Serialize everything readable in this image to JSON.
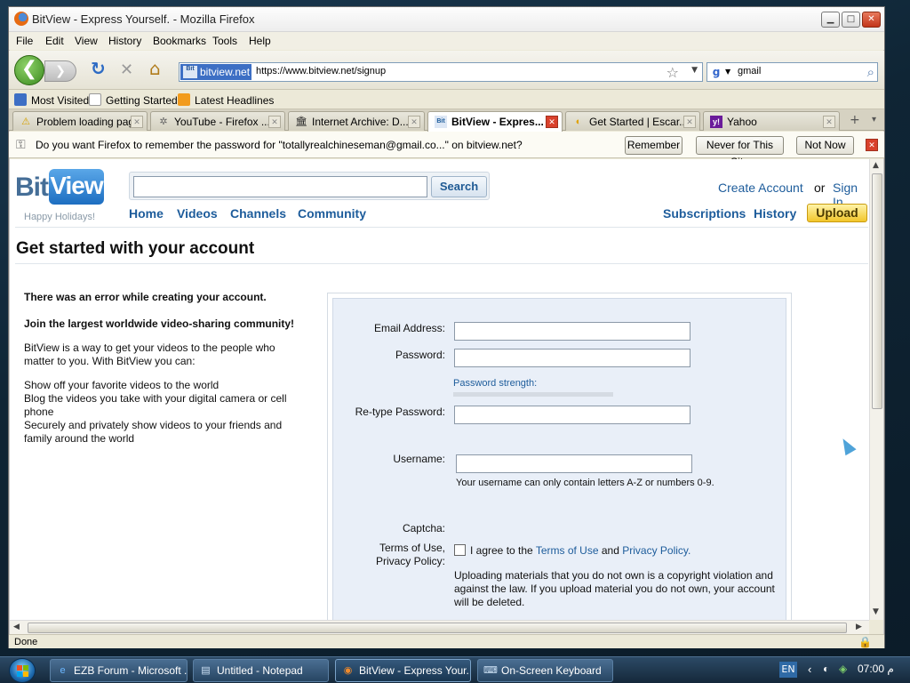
{
  "window": {
    "title": "BitView - Express Yourself. - Mozilla Firefox",
    "controls": {
      "minimize": "▁",
      "maximize": "□",
      "close": "✕"
    }
  },
  "menu": [
    "File",
    "Edit",
    "View",
    "History",
    "Bookmarks",
    "Tools",
    "Help"
  ],
  "nav": {
    "back": "❮",
    "forward": "❯",
    "reload": "↻",
    "stop": "✕",
    "home": "⌂",
    "site_identity": "bitview.net",
    "site_icon_text": "Bit",
    "url": "https://www.bitview.net/signup",
    "search_engine": "g",
    "search_value": "gmail"
  },
  "bookmarks": [
    {
      "label": "Most Visited",
      "icon": "most-visited-icon",
      "color": "#3d6fc4"
    },
    {
      "label": "Getting Started",
      "icon": "page-icon",
      "color": "#ffffff"
    },
    {
      "label": "Latest Headlines",
      "icon": "rss-icon",
      "color": "#f29b1c"
    }
  ],
  "tabs": [
    {
      "label": "Problem loading page",
      "icon": "⚠",
      "active": false
    },
    {
      "label": "YouTube - Firefox ...",
      "icon": "✲",
      "active": false
    },
    {
      "label": "Internet Archive: D...",
      "icon": "🏛",
      "active": false
    },
    {
      "label": "BitView - Expres...",
      "icon": "Bit",
      "active": true
    },
    {
      "label": "Get Started | Escar...",
      "icon": "◐",
      "active": false
    },
    {
      "label": "Yahoo",
      "icon": "y!",
      "active": false
    }
  ],
  "tabstrip": {
    "new_tab": "+",
    "list": "▾"
  },
  "notification": {
    "message": "Do you want Firefox to remember the password for \"totallyrealchineseman@gmail.co...\" on bitview.net?",
    "remember": "Remember",
    "never": "Never for This Site",
    "not_now": "Not Now"
  },
  "site": {
    "logo_bit": "Bit",
    "logo_view": "View",
    "logo_tagline": "Happy Holidays!",
    "search_button": "Search",
    "nav": [
      "Home",
      "Videos",
      "Channels",
      "Community"
    ],
    "create_account": "Create Account",
    "or": "or",
    "sign_in": "Sign In",
    "subscriptions": "Subscriptions",
    "history": "History",
    "upload": "Upload",
    "page_title": "Get started with your account"
  },
  "left": {
    "error": "There was an error while creating your account.",
    "join": "Join the largest worldwide video-sharing community!",
    "intro": "BitView is a way to get your videos to the people who matter to you. With BitView you can:",
    "bullets": [
      "Show off your favorite videos to the world",
      "Blog the videos you take with your digital camera or cell phone",
      "Securely and privately show videos to your friends and family around the world"
    ]
  },
  "form": {
    "email_label": "Email Address:",
    "password_label": "Password:",
    "password_strength": "Password strength:",
    "retype_label": "Re-type Password:",
    "username_label": "Username:",
    "username_hint": "Your username can only contain letters A-Z or numbers 0-9.",
    "captcha_label": "Captcha:",
    "terms_label_1": "Terms of Use,",
    "terms_label_2": "Privacy Policy:",
    "agree_prefix": "I agree to the",
    "terms_link": "Terms of Use",
    "and": "and",
    "privacy_link": "Privacy Policy.",
    "warning": "Uploading materials that you do not own is a copyright violation and against the law. If you upload material you do not own, your account will be deleted."
  },
  "status": {
    "text": "Done"
  },
  "taskbar": {
    "items": [
      {
        "label": "EZB Forum - Microsoft ...",
        "icon": "e",
        "active": false
      },
      {
        "label": "Untitled - Notepad",
        "icon": "▤",
        "active": false
      },
      {
        "label": "BitView - Express Your...",
        "icon": "◉",
        "active": true
      },
      {
        "label": "On-Screen Keyboard",
        "icon": "⌨",
        "active": false
      }
    ],
    "language": "EN",
    "time": "07:00 م"
  }
}
